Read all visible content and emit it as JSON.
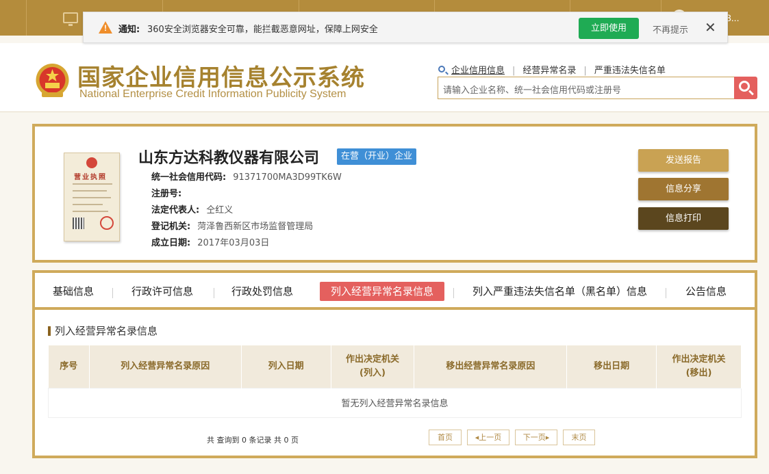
{
  "topbar": {
    "user_text": "3..."
  },
  "notice": {
    "label": "通知:",
    "message": "360安全浏览器安全可靠，能拦截恶意网址，保障上网安全",
    "use_button": "立即使用",
    "dismiss": "不再提示",
    "close": "✕"
  },
  "header": {
    "title": "国家企业信用信息公示系统",
    "subtitle": "National Enterprise Credit Information Publicity System",
    "links": [
      "企业信用信息",
      "经营异常名录",
      "严重违法失信名单"
    ],
    "search_placeholder": "请输入企业名称、统一社会信用代码或注册号"
  },
  "company": {
    "name": "山东方达科教仪器有限公司",
    "status": "在营（开业）企业",
    "license_title": "营业执照",
    "fields": [
      {
        "label": "统一社会信用代码:",
        "value": "91371700MA3D99TK6W"
      },
      {
        "label": "注册号:",
        "value": ""
      },
      {
        "label": "法定代表人:",
        "value": "仝红义"
      },
      {
        "label": "登记机关:",
        "value": "菏泽鲁西新区市场监督管理局"
      },
      {
        "label": "成立日期:",
        "value": "2017年03月03日"
      }
    ],
    "buttons": [
      "发送报告",
      "信息分享",
      "信息打印"
    ]
  },
  "tabs": [
    "基础信息",
    "行政许可信息",
    "行政处罚信息",
    "列入经营异常名录信息",
    "列入严重违法失信名单（黑名单）信息",
    "公告信息"
  ],
  "active_tab": "列入经营异常名录信息",
  "section": {
    "title": "列入经营异常名录信息",
    "columns": [
      "序号",
      "列入经营异常名录原因",
      "列入日期",
      "作出决定机关(列入)",
      "移出经营异常名录原因",
      "移出日期",
      "作出决定机关(移出)"
    ],
    "empty_text": "暂无列入经营异常名录信息"
  },
  "pager": {
    "summary": "共 查询到 0 条记录 共 0 页",
    "first": "首页",
    "prev": "上一页",
    "next": "下一页",
    "last": "末页"
  },
  "colors": {
    "gold": "#cfaa5b",
    "accent_red": "#e4605e",
    "status_blue": "#3f8fd6",
    "green": "#1fab54"
  }
}
